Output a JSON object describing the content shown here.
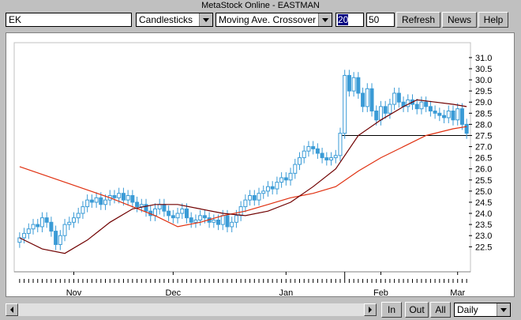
{
  "window": {
    "title": "MetaStock Online - EASTMAN"
  },
  "toolbar": {
    "symbol": "EK",
    "chart_type": "Candlesticks",
    "indicator": "Moving Ave. Crossover",
    "period1": "20",
    "period2": "50",
    "refresh_label": "Refresh",
    "news_label": "News",
    "help_label": "Help"
  },
  "bottom": {
    "in_label": "In",
    "out_label": "Out",
    "all_label": "All",
    "interval": "Daily"
  },
  "colors": {
    "bull": "#3a9bd6",
    "bear": "#3a9bd6",
    "ma_fast": "#700000",
    "ma_slow": "#e03010",
    "accent": "#000080"
  },
  "chart_data": {
    "type": "candlestick",
    "x_labels": [
      "Nov",
      "Dec",
      "Jan",
      "Feb",
      "Mar"
    ],
    "y_ticks": [
      22.5,
      23.0,
      23.5,
      24.0,
      24.5,
      25.0,
      25.5,
      26.0,
      26.5,
      27.0,
      27.5,
      28.0,
      28.5,
      29.0,
      29.5,
      30.0,
      30.5,
      31.0
    ],
    "ylim": [
      21.8,
      31.6
    ],
    "reference_line": 27.5,
    "closes": [
      22.9,
      23.1,
      23.3,
      23.5,
      23.4,
      23.8,
      23.6,
      23.2,
      22.6,
      23.0,
      23.5,
      23.6,
      23.8,
      24.0,
      24.3,
      24.6,
      24.5,
      24.7,
      24.4,
      24.6,
      24.8,
      24.7,
      24.9,
      24.6,
      24.8,
      24.5,
      24.3,
      24.4,
      24.1,
      23.9,
      24.2,
      24.4,
      24.1,
      23.9,
      23.8,
      24.0,
      24.2,
      23.8,
      23.6,
      23.7,
      23.9,
      23.8,
      23.6,
      23.7,
      23.5,
      23.9,
      23.4,
      23.6,
      23.9,
      24.3,
      24.6,
      24.8,
      24.6,
      24.9,
      25.0,
      25.2,
      25.1,
      25.4,
      25.6,
      25.5,
      25.8,
      26.2,
      26.5,
      26.8,
      27.0,
      26.9,
      26.7,
      26.5,
      26.4,
      26.5,
      26.6,
      27.6,
      30.2,
      29.5,
      30.1,
      29.4,
      28.8,
      29.6,
      28.6,
      28.2,
      28.8,
      28.5,
      28.9,
      29.4,
      29.0,
      28.8,
      29.1,
      28.9,
      28.7,
      29.0,
      28.8,
      28.6,
      28.5,
      28.4,
      28.3,
      28.6,
      28.2,
      28.7,
      28.0,
      27.6
    ],
    "ma_fast": {
      "name": "",
      "points": [
        [
          0,
          22.9
        ],
        [
          5,
          22.4
        ],
        [
          10,
          22.2
        ],
        [
          15,
          22.8
        ],
        [
          20,
          23.6
        ],
        [
          25,
          24.2
        ],
        [
          30,
          24.4
        ],
        [
          35,
          24.4
        ],
        [
          40,
          24.2
        ],
        [
          45,
          24.0
        ],
        [
          50,
          23.9
        ],
        [
          55,
          24.1
        ],
        [
          60,
          24.5
        ],
        [
          65,
          25.2
        ],
        [
          70,
          26.0
        ],
        [
          75,
          27.5
        ],
        [
          80,
          28.2
        ],
        [
          85,
          28.8
        ],
        [
          88,
          29.1
        ],
        [
          92,
          29.0
        ],
        [
          96,
          28.9
        ],
        [
          99,
          28.8
        ]
      ]
    },
    "ma_slow": {
      "name": "",
      "points": [
        [
          0,
          26.1
        ],
        [
          10,
          25.4
        ],
        [
          20,
          24.7
        ],
        [
          30,
          23.9
        ],
        [
          35,
          23.4
        ],
        [
          40,
          23.6
        ],
        [
          45,
          23.9
        ],
        [
          50,
          24.1
        ],
        [
          55,
          24.4
        ],
        [
          60,
          24.7
        ],
        [
          65,
          24.9
        ],
        [
          70,
          25.2
        ],
        [
          75,
          25.9
        ],
        [
          80,
          26.5
        ],
        [
          85,
          27.0
        ],
        [
          90,
          27.5
        ],
        [
          96,
          27.8
        ],
        [
          99,
          27.9
        ]
      ]
    }
  }
}
